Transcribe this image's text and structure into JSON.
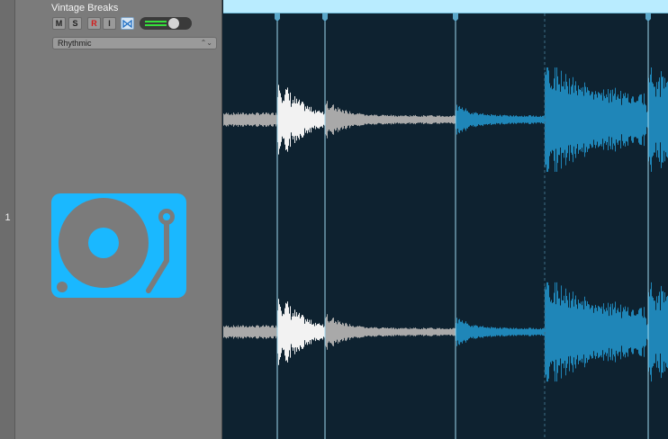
{
  "track": {
    "number": "1",
    "name": "Vintage Breaks",
    "buttons": {
      "mute": "M",
      "solo": "S",
      "record": "R",
      "input": "I"
    },
    "groove": "Rhythmic",
    "icon": "turntable-icon",
    "volume_level": 0.55
  },
  "region": {
    "color": "#b9ecff",
    "waveform_played_color": "#f2f2f2",
    "waveform_gray_color": "#a9a9a9",
    "waveform_blue_color": "#1f86b8",
    "transient_markers": 4,
    "channels": 2
  },
  "colors": {
    "background": "#0e2230",
    "track_icon": "#1ab8ff",
    "meter": "#36e03c"
  }
}
